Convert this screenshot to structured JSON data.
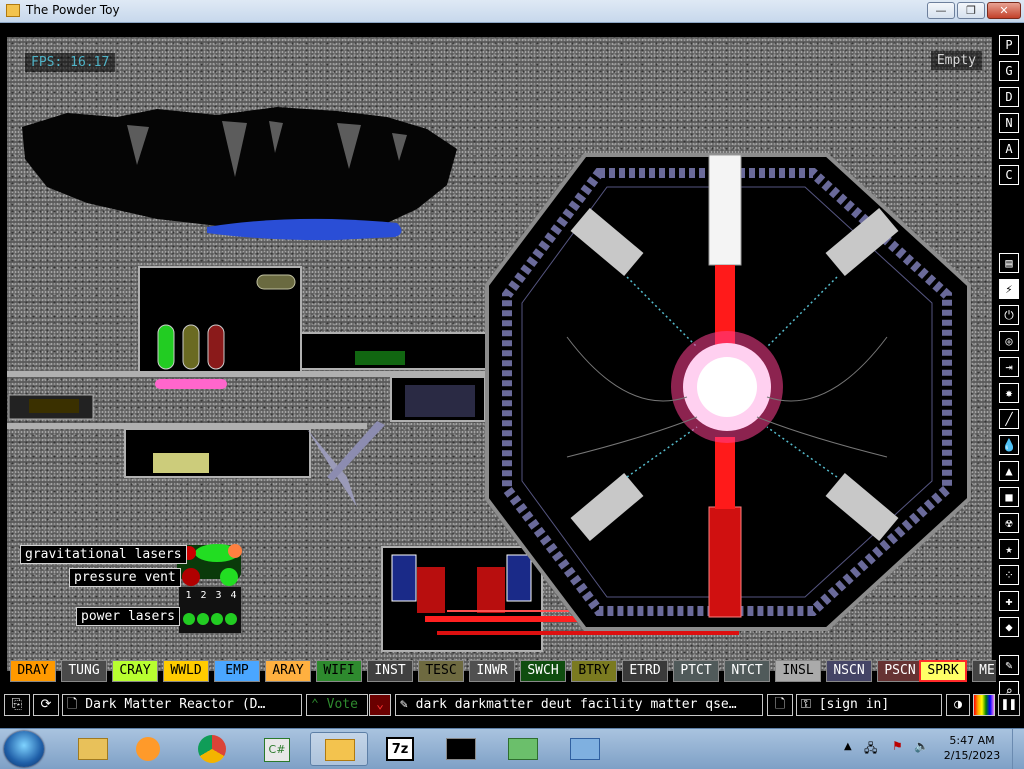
{
  "window": {
    "title": "The Powder Toy",
    "minimize": "—",
    "maximize": "❐",
    "close": "✕"
  },
  "hud": {
    "fps": "FPS: 16.17",
    "status": "Empty"
  },
  "signs": {
    "gravitational": "gravitational lasers",
    "pressure": "pressure vent",
    "power": "power lasers",
    "numbers": [
      "1",
      "2",
      "3",
      "4"
    ]
  },
  "right_menu": {
    "top": [
      "P",
      "G",
      "D",
      "N",
      "A",
      "C"
    ],
    "icons": [
      "wall-icon",
      "electronics-icon",
      "power-icon",
      "sensor-icon",
      "force-icon",
      "explosive-icon",
      "gas-icon",
      "liquid-icon",
      "powder-icon",
      "solid-icon",
      "radioactive-icon",
      "special-icon",
      "life-icon",
      "tools-icon",
      "favorite-icon",
      "decoration-icon",
      "search-icon"
    ]
  },
  "elements": [
    {
      "label": "DRAY",
      "bg": "#ff9900",
      "fg": "#000000"
    },
    {
      "label": "TUNG",
      "bg": "#4a4a4a",
      "fg": "#ffffff"
    },
    {
      "label": "CRAY",
      "bg": "#b8ff30",
      "fg": "#000000"
    },
    {
      "label": "WWLD",
      "bg": "#ffcc00",
      "fg": "#000000"
    },
    {
      "label": "EMP",
      "bg": "#4aa6ff",
      "fg": "#000000"
    },
    {
      "label": "ARAY",
      "bg": "#ffb040",
      "fg": "#000000"
    },
    {
      "label": "WIFI",
      "bg": "#2e8a2e",
      "fg": "#000000"
    },
    {
      "label": "INST",
      "bg": "#404040",
      "fg": "#ffffff"
    },
    {
      "label": "TESC",
      "bg": "#6e6a40",
      "fg": "#000000"
    },
    {
      "label": "INWR",
      "bg": "#505050",
      "fg": "#ffffff"
    },
    {
      "label": "SWCH",
      "bg": "#0f4d0f",
      "fg": "#ffffff"
    },
    {
      "label": "BTRY",
      "bg": "#7a7a20",
      "fg": "#000000"
    },
    {
      "label": "ETRD",
      "bg": "#3a3a3a",
      "fg": "#ffffff"
    },
    {
      "label": "PTCT",
      "bg": "#505a5a",
      "fg": "#ffffff"
    },
    {
      "label": "NTCT",
      "bg": "#505a5a",
      "fg": "#ffffff"
    },
    {
      "label": "INSL",
      "bg": "#aaaaaa",
      "fg": "#000000"
    },
    {
      "label": "NSCN",
      "bg": "#444466",
      "fg": "#ffffff"
    },
    {
      "label": "PSCN",
      "bg": "#663333",
      "fg": "#ffffff"
    },
    {
      "label": "SPRK",
      "bg": "#ffff66",
      "fg": "#000000",
      "selected": true
    },
    {
      "label": "ME",
      "bg": "#444444",
      "fg": "#ffffff"
    }
  ],
  "bottom": {
    "save_title": "Dark Matter Reactor (D…",
    "vote": "Vote",
    "tags": "dark darkmatter deut facility matter qse…",
    "login": "[sign in]"
  },
  "colors": {
    "accent_red": "#ff2a2a",
    "fps": "#4fb3c7"
  },
  "clock": {
    "time": "5:47 AM",
    "date": "2/15/2023"
  }
}
